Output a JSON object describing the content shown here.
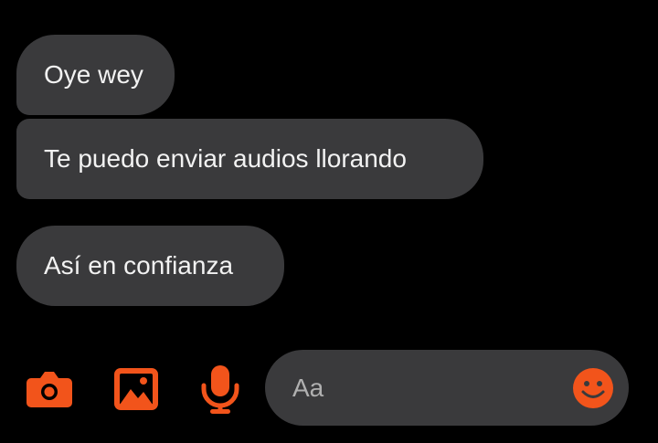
{
  "messages": [
    {
      "text": "Oye wey"
    },
    {
      "text": "Te puedo enviar audios llorando"
    },
    {
      "text": "Así en confianza"
    }
  ],
  "composer": {
    "placeholder": "Aa",
    "icons": [
      "camera-icon",
      "image-icon",
      "microphone-icon",
      "emoji-icon"
    ]
  },
  "colors": {
    "background": "#000000",
    "bubble": "#3a3a3c",
    "text": "#f2f2f2",
    "accent": "#f2541b",
    "placeholder": "#b0b0b0"
  }
}
